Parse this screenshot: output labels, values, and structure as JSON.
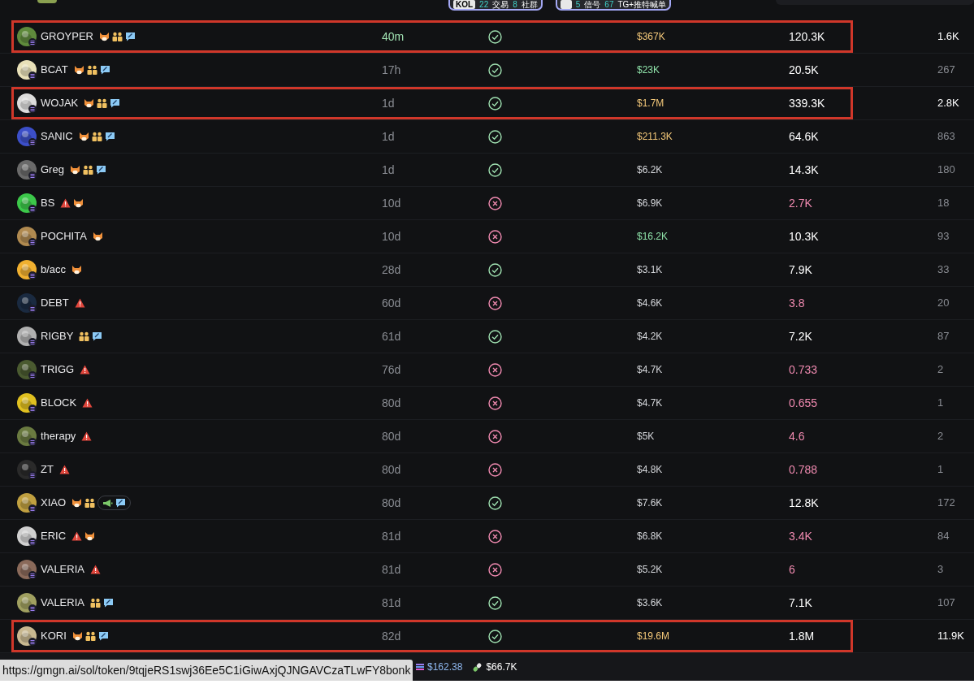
{
  "top_bar": {
    "pills": [
      {
        "items": [
          {
            "kind": "tag",
            "text": "KOL"
          },
          {
            "kind": "count",
            "text": "22"
          },
          {
            "kind": "label",
            "text": "交易"
          },
          {
            "kind": "count",
            "text": "8"
          },
          {
            "kind": "label",
            "text": "社群"
          }
        ]
      },
      {
        "items": [
          {
            "kind": "icon"
          },
          {
            "kind": "count",
            "text": "5"
          },
          {
            "kind": "label",
            "text": "信号"
          },
          {
            "kind": "count",
            "text": "67"
          },
          {
            "kind": "label",
            "text": "TG+推特喊单"
          }
        ]
      }
    ]
  },
  "rows": [
    {
      "name": "GROYPER",
      "highlighted": true,
      "badges": [
        {
          "kind": "dog"
        },
        {
          "kind": "people"
        },
        {
          "kind": "chat"
        }
      ],
      "age": {
        "text": "40m",
        "color": "#9fe0b0"
      },
      "ok": true,
      "market_cap": {
        "text": "$367K",
        "color": "#f5c97a"
      },
      "column_5": {
        "text": "120.3K",
        "color": "#ffffff"
      },
      "column_6": {
        "text": "1.6K",
        "color": "#ffffff"
      }
    },
    {
      "name": "BCAT",
      "highlighted": false,
      "badges": [
        {
          "kind": "dog"
        },
        {
          "kind": "people"
        },
        {
          "kind": "chat"
        }
      ],
      "age": {
        "text": "17h",
        "color": "#8a8d93"
      },
      "ok": true,
      "market_cap": {
        "text": "$23K",
        "color": "#8ee0a8"
      },
      "column_5": {
        "text": "20.5K",
        "color": "#ffffff"
      },
      "column_6": {
        "text": "267",
        "color": "#8a8d93"
      }
    },
    {
      "name": "WOJAK",
      "highlighted": true,
      "badges": [
        {
          "kind": "dog"
        },
        {
          "kind": "people"
        },
        {
          "kind": "chat"
        }
      ],
      "age": {
        "text": "1d",
        "color": "#8a8d93"
      },
      "ok": true,
      "market_cap": {
        "text": "$1.7M",
        "color": "#f5c97a"
      },
      "column_5": {
        "text": "339.3K",
        "color": "#ffffff"
      },
      "column_6": {
        "text": "2.8K",
        "color": "#ffffff"
      }
    },
    {
      "name": "SANIC",
      "highlighted": false,
      "badges": [
        {
          "kind": "dog"
        },
        {
          "kind": "people"
        },
        {
          "kind": "chat"
        }
      ],
      "age": {
        "text": "1d",
        "color": "#8a8d93"
      },
      "ok": true,
      "market_cap": {
        "text": "$211.3K",
        "color": "#f5c97a"
      },
      "column_5": {
        "text": "64.6K",
        "color": "#ffffff"
      },
      "column_6": {
        "text": "863",
        "color": "#8a8d93"
      }
    },
    {
      "name": "Greg",
      "highlighted": false,
      "badges": [
        {
          "kind": "dog"
        },
        {
          "kind": "people"
        },
        {
          "kind": "chat"
        }
      ],
      "age": {
        "text": "1d",
        "color": "#8a8d93"
      },
      "ok": true,
      "market_cap": {
        "text": "$6.2K",
        "color": "#d4d6da"
      },
      "column_5": {
        "text": "14.3K",
        "color": "#ffffff"
      },
      "column_6": {
        "text": "180",
        "color": "#8a8d93"
      }
    },
    {
      "name": "BS",
      "highlighted": false,
      "badges": [
        {
          "kind": "warning"
        },
        {
          "kind": "dog"
        }
      ],
      "age": {
        "text": "10d",
        "color": "#8a8d93"
      },
      "ok": false,
      "market_cap": {
        "text": "$6.9K",
        "color": "#d4d6da"
      },
      "column_5": {
        "text": "2.7K",
        "color": "#f08ab0"
      },
      "column_6": {
        "text": "18",
        "color": "#8a8d93"
      }
    },
    {
      "name": "POCHITA",
      "highlighted": false,
      "badges": [
        {
          "kind": "dog"
        }
      ],
      "age": {
        "text": "10d",
        "color": "#8a8d93"
      },
      "ok": false,
      "market_cap": {
        "text": "$16.2K",
        "color": "#8ee0a8"
      },
      "column_5": {
        "text": "10.3K",
        "color": "#ffffff"
      },
      "column_6": {
        "text": "93",
        "color": "#8a8d93"
      }
    },
    {
      "name": "b/acc",
      "highlighted": false,
      "badges": [
        {
          "kind": "dog"
        }
      ],
      "age": {
        "text": "28d",
        "color": "#8a8d93"
      },
      "ok": true,
      "market_cap": {
        "text": "$3.1K",
        "color": "#d4d6da"
      },
      "column_5": {
        "text": "7.9K",
        "color": "#ffffff"
      },
      "column_6": {
        "text": "33",
        "color": "#8a8d93"
      }
    },
    {
      "name": "DEBT",
      "highlighted": false,
      "badges": [
        {
          "kind": "warning"
        }
      ],
      "age": {
        "text": "60d",
        "color": "#8a8d93"
      },
      "ok": false,
      "market_cap": {
        "text": "$4.6K",
        "color": "#d4d6da"
      },
      "column_5": {
        "text": "3.8",
        "color": "#f08ab0"
      },
      "column_6": {
        "text": "20",
        "color": "#8a8d93"
      }
    },
    {
      "name": "RIGBY",
      "highlighted": false,
      "badges": [
        {
          "kind": "people"
        },
        {
          "kind": "chat"
        }
      ],
      "age": {
        "text": "61d",
        "color": "#8a8d93"
      },
      "ok": true,
      "market_cap": {
        "text": "$4.2K",
        "color": "#d4d6da"
      },
      "column_5": {
        "text": "7.2K",
        "color": "#ffffff"
      },
      "column_6": {
        "text": "87",
        "color": "#8a8d93"
      }
    },
    {
      "name": "TRIGG",
      "highlighted": false,
      "badges": [
        {
          "kind": "warning"
        }
      ],
      "age": {
        "text": "76d",
        "color": "#8a8d93"
      },
      "ok": false,
      "market_cap": {
        "text": "$4.7K",
        "color": "#d4d6da"
      },
      "column_5": {
        "text": "0.733",
        "color": "#f08ab0"
      },
      "column_6": {
        "text": "2",
        "color": "#8a8d93"
      }
    },
    {
      "name": "BLOCK",
      "highlighted": false,
      "badges": [
        {
          "kind": "warning"
        }
      ],
      "age": {
        "text": "80d",
        "color": "#8a8d93"
      },
      "ok": false,
      "market_cap": {
        "text": "$4.7K",
        "color": "#d4d6da"
      },
      "column_5": {
        "text": "0.655",
        "color": "#f08ab0"
      },
      "column_6": {
        "text": "1",
        "color": "#8a8d93"
      }
    },
    {
      "name": "therapy",
      "highlighted": false,
      "badges": [
        {
          "kind": "warning"
        }
      ],
      "age": {
        "text": "80d",
        "color": "#8a8d93"
      },
      "ok": false,
      "market_cap": {
        "text": "$5K",
        "color": "#d4d6da"
      },
      "column_5": {
        "text": "4.6",
        "color": "#f08ab0"
      },
      "column_6": {
        "text": "2",
        "color": "#8a8d93"
      }
    },
    {
      "name": "ZT",
      "highlighted": false,
      "badges": [
        {
          "kind": "warning"
        }
      ],
      "age": {
        "text": "80d",
        "color": "#8a8d93"
      },
      "ok": false,
      "market_cap": {
        "text": "$4.8K",
        "color": "#d4d6da"
      },
      "column_5": {
        "text": "0.788",
        "color": "#f08ab0"
      },
      "column_6": {
        "text": "1",
        "color": "#8a8d93"
      }
    },
    {
      "name": "XIAO",
      "highlighted": false,
      "badges": [
        {
          "kind": "dog"
        },
        {
          "kind": "people"
        },
        {
          "kind": "pill"
        }
      ],
      "age": {
        "text": "80d",
        "color": "#8a8d93"
      },
      "ok": true,
      "market_cap": {
        "text": "$7.6K",
        "color": "#d4d6da"
      },
      "column_5": {
        "text": "12.8K",
        "color": "#ffffff"
      },
      "column_6": {
        "text": "172",
        "color": "#8a8d93"
      }
    },
    {
      "name": "ERIC",
      "highlighted": false,
      "badges": [
        {
          "kind": "warning"
        },
        {
          "kind": "dog"
        }
      ],
      "age": {
        "text": "81d",
        "color": "#8a8d93"
      },
      "ok": false,
      "market_cap": {
        "text": "$6.8K",
        "color": "#d4d6da"
      },
      "column_5": {
        "text": "3.4K",
        "color": "#f08ab0"
      },
      "column_6": {
        "text": "84",
        "color": "#8a8d93"
      }
    },
    {
      "name": "VALERIA",
      "highlighted": false,
      "badges": [
        {
          "kind": "warning"
        }
      ],
      "age": {
        "text": "81d",
        "color": "#8a8d93"
      },
      "ok": false,
      "market_cap": {
        "text": "$5.2K",
        "color": "#d4d6da"
      },
      "column_5": {
        "text": "6",
        "color": "#f08ab0"
      },
      "column_6": {
        "text": "3",
        "color": "#8a8d93"
      }
    },
    {
      "name": "VALERIA",
      "highlighted": false,
      "badges": [
        {
          "kind": "people"
        },
        {
          "kind": "chat"
        }
      ],
      "age": {
        "text": "81d",
        "color": "#8a8d93"
      },
      "ok": true,
      "market_cap": {
        "text": "$3.6K",
        "color": "#d4d6da"
      },
      "column_5": {
        "text": "7.1K",
        "color": "#ffffff"
      },
      "column_6": {
        "text": "107",
        "color": "#8a8d93"
      }
    },
    {
      "name": "KORI",
      "highlighted": true,
      "badges": [
        {
          "kind": "dog"
        },
        {
          "kind": "people"
        },
        {
          "kind": "chat"
        }
      ],
      "age": {
        "text": "82d",
        "color": "#8a8d93"
      },
      "ok": true,
      "market_cap": {
        "text": "$19.6M",
        "color": "#f5c97a"
      },
      "column_5": {
        "text": "1.8M",
        "color": "#ffffff"
      },
      "column_6": {
        "text": "11.9K",
        "color": "#ffffff"
      }
    }
  ],
  "status_bar": {
    "sol_price": "$162.38",
    "other_value": "$66.7K"
  },
  "link_tooltip": "https://gmgn.ai/sol/token/9tqjeRS1swj36Ee5C1iGiwAxjQJNGAVCzaTLwFY8bonk"
}
